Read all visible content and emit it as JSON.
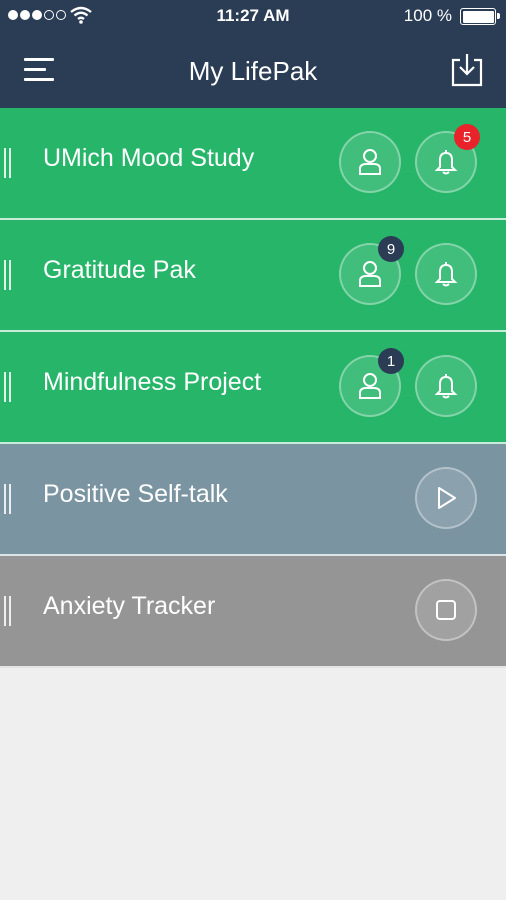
{
  "status_bar": {
    "time": "11:27 AM",
    "battery": "100 %"
  },
  "header": {
    "title": "My LifePak"
  },
  "paks": [
    {
      "name": "UMich Mood Study",
      "style": "green",
      "profile_badge": "",
      "bell_badge": "5"
    },
    {
      "name": "Gratitude Pak",
      "style": "green",
      "profile_badge": "9",
      "bell_badge": ""
    },
    {
      "name": "Mindfulness Project",
      "style": "green",
      "profile_badge": "1",
      "bell_badge": ""
    },
    {
      "name": "Positive Self-talk",
      "style": "slate",
      "action": "play"
    },
    {
      "name": "Anxiety Tracker",
      "style": "gray",
      "action": "stop"
    }
  ],
  "colors": {
    "header": "#2b3d55",
    "active": "#27b56a",
    "paused": "#7b94a2",
    "stopped": "#959595",
    "alert_badge": "#e8232a"
  },
  "icons": [
    "menu-icon",
    "download-icon",
    "profile-icon",
    "bell-icon",
    "play-icon",
    "stop-icon",
    "drag-handle-icon"
  ]
}
